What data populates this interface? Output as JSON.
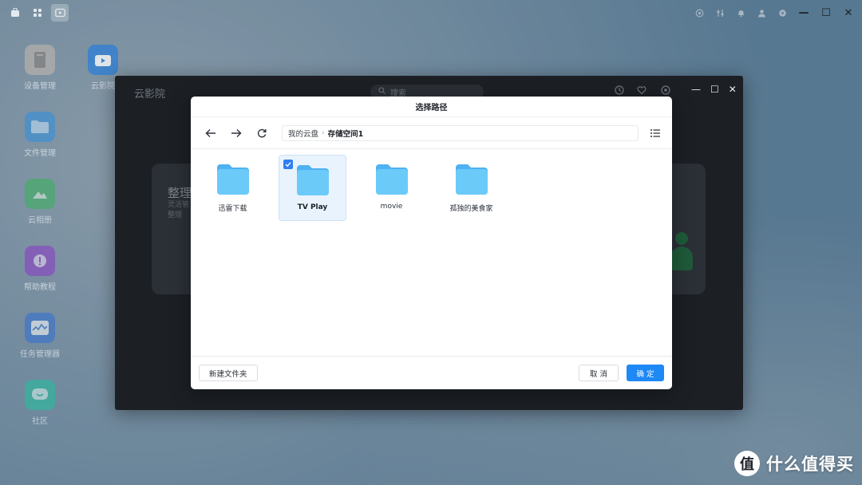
{
  "taskbar": {
    "left_icons": [
      "store-icon",
      "apps-grid-icon",
      "video-app-icon"
    ],
    "right_icons": [
      "broadcast-icon",
      "equalizer-icon",
      "bell-icon",
      "user-icon",
      "settings-icon"
    ],
    "window_controls": [
      "—",
      "☐",
      "✕"
    ]
  },
  "desktop": {
    "icons": [
      {
        "label": "设备管理",
        "icon": "server-icon",
        "color": "#b8a89c"
      },
      {
        "label": "云影院",
        "icon": "tv-icon",
        "color": "#2d7fd8"
      },
      {
        "label": "文件管理",
        "icon": "folder-icon",
        "color": "#2e8fe0"
      },
      {
        "label": "云相册",
        "icon": "photo-icon",
        "color": "#36b25a"
      },
      {
        "label": "帮助教程",
        "icon": "help-icon",
        "color": "#8b38c9"
      },
      {
        "label": "任务管理器",
        "icon": "monitor-icon",
        "color": "#2f6fd6"
      },
      {
        "label": "社区",
        "icon": "chat-icon",
        "color": "#1fc2a0"
      }
    ]
  },
  "app_window": {
    "title": "云影院",
    "search_placeholder": "搜索",
    "card_title": "整理",
    "card_subtitle_line1": "灵活管",
    "card_subtitle_line2": "整理"
  },
  "dialog": {
    "title": "选择路径",
    "breadcrumb": {
      "root": "我的云盘",
      "separator": "›",
      "current": "存储空间1"
    },
    "folders": [
      {
        "name": "迅雷下载",
        "selected": false
      },
      {
        "name": "TV Play",
        "selected": true
      },
      {
        "name": "movie",
        "selected": false
      },
      {
        "name": "孤独的美食家",
        "selected": false
      }
    ],
    "new_folder_label": "新建文件夹",
    "cancel_label": "取 消",
    "confirm_label": "确 定"
  },
  "watermark": {
    "logo_char": "值",
    "text": "什么值得买"
  },
  "colors": {
    "primary": "#1e88f5",
    "folder": "#5bbdf6",
    "selected_bg": "#e9f3fd"
  }
}
